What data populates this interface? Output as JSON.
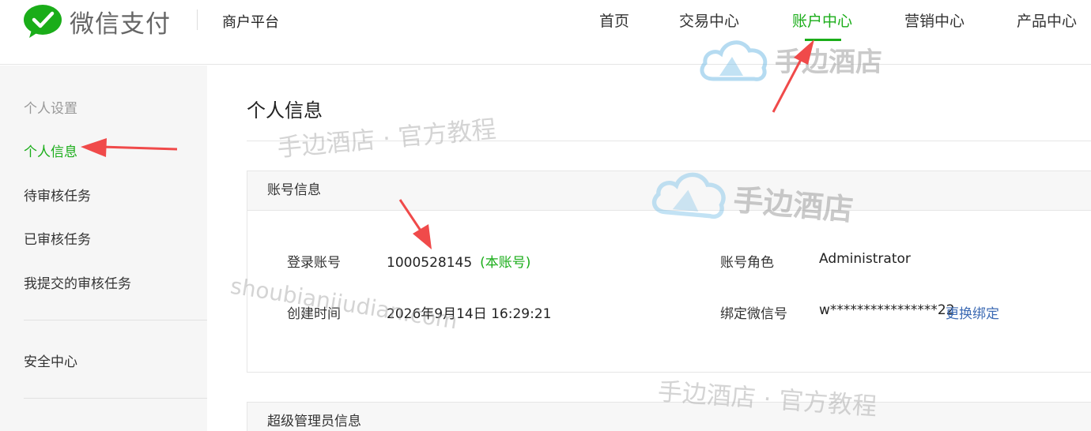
{
  "header": {
    "brand": "微信支付",
    "platform": "商户平台",
    "nav": [
      {
        "label": "首页"
      },
      {
        "label": "交易中心"
      },
      {
        "label": "账户中心"
      },
      {
        "label": "营销中心"
      },
      {
        "label": "产品中心"
      }
    ],
    "active_nav": "账户中心"
  },
  "sidebar": {
    "group_title": "个人设置",
    "items": [
      {
        "label": "个人信息"
      },
      {
        "label": "待审核任务"
      },
      {
        "label": "已审核任务"
      },
      {
        "label": "我提交的审核任务"
      },
      {
        "label": "安全中心"
      }
    ],
    "active_item": "个人信息"
  },
  "main": {
    "title": "个人信息",
    "account_panel": {
      "heading": "账号信息",
      "login_label": "登录账号",
      "login_value": "1000528145",
      "login_tag": "(本账号)",
      "role_label": "账号角色",
      "role_value": "Administrator",
      "created_label": "创建时间",
      "created_value": "2026年9月14日 16:29:21",
      "wechat_label": "绑定微信号",
      "wechat_value": "w****************22",
      "wechat_link": "更换绑定"
    },
    "admin_panel": {
      "heading": "超级管理员信息"
    }
  },
  "watermarks": {
    "brand_text": "手边酒店",
    "tutorial_text": "手边酒店 · 官方教程",
    "domain_text": "shoubianjiudian.com"
  },
  "colors": {
    "accent": "#1aad19",
    "link": "#3d6bb4",
    "annotation_arrow": "#f04a4a"
  }
}
